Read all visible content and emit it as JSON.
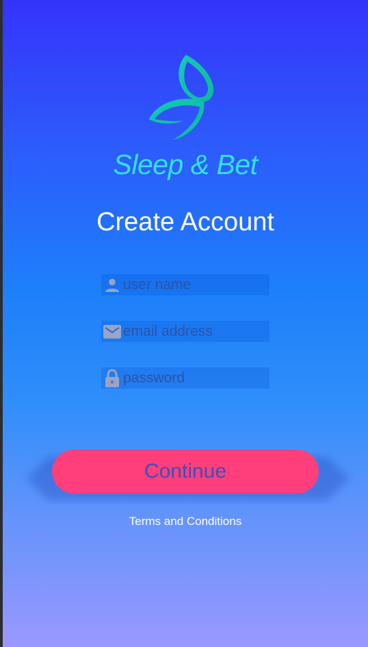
{
  "brand": {
    "name": "Sleep & Bet",
    "logo_icon": "butterfly-leaf-logo"
  },
  "page": {
    "title": "Create Account"
  },
  "form": {
    "username": {
      "placeholder": "user name",
      "value": "",
      "icon": "person-icon"
    },
    "email": {
      "placeholder": "email address",
      "value": "",
      "icon": "mail-icon"
    },
    "password": {
      "placeholder": "password",
      "value": "",
      "icon": "lock-icon"
    }
  },
  "actions": {
    "continue_label": "Continue",
    "terms_label": "Terms and Conditions"
  },
  "colors": {
    "brand_text": "#34e0e6",
    "button": "#ff3f7c",
    "button_text": "#3d4fb8",
    "icon_gray": "#9aa4c4",
    "gradient_top": "#3434fb",
    "gradient_bottom": "#9a98ff"
  }
}
